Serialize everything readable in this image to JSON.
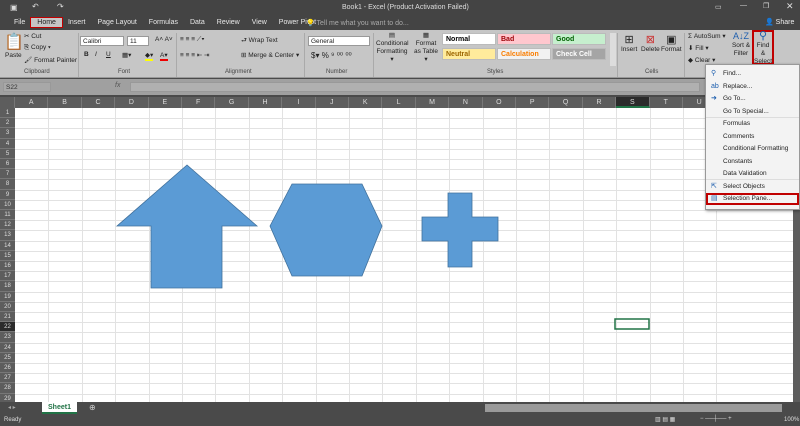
{
  "title": "Book1 - Excel (Product Activation Failed)",
  "tabs": [
    "File",
    "Home",
    "Insert",
    "Page Layout",
    "Formulas",
    "Data",
    "Review",
    "View",
    "Power Pivot"
  ],
  "tell_me": "Tell me what you want to do...",
  "share": "Share",
  "clipboard": {
    "paste": "Paste",
    "cut": "Cut",
    "copy": "Copy",
    "format_painter": "Format Painter",
    "label": "Clipboard"
  },
  "font": {
    "name": "Calibri",
    "size": "11",
    "label": "Font",
    "bold": "B",
    "italic": "I",
    "underline": "U"
  },
  "alignment": {
    "wrap": "Wrap Text",
    "merge": "Merge & Center",
    "label": "Alignment"
  },
  "number": {
    "format": "General",
    "label": "Number",
    "currency": "$",
    "percent": "%"
  },
  "styles": {
    "conditional": "Conditional Formatting",
    "format_table": "Format as Table",
    "label": "Styles",
    "cells": [
      {
        "t": "Normal",
        "bg": "#ffffff",
        "c": "#000"
      },
      {
        "t": "Bad",
        "bg": "#ffc7ce",
        "c": "#9c0006"
      },
      {
        "t": "Good",
        "bg": "#c6efce",
        "c": "#006100"
      },
      {
        "t": "Neutral",
        "bg": "#ffeb9c",
        "c": "#9c6500"
      },
      {
        "t": "Calculation",
        "bg": "#f2f2f2",
        "c": "#fa7d00"
      },
      {
        "t": "Check Cell",
        "bg": "#a5a5a5",
        "c": "#ffffff"
      }
    ]
  },
  "cells": {
    "insert": "Insert",
    "delete": "Delete",
    "format": "Format",
    "label": "Cells"
  },
  "editing": {
    "autosum": "AutoSum",
    "fill": "Fill",
    "clear": "Clear",
    "sort": "Sort & Filter",
    "find": "Find & Select"
  },
  "name_box": "S22",
  "fx": "fx",
  "columns": [
    "A",
    "B",
    "C",
    "D",
    "E",
    "F",
    "G",
    "H",
    "I",
    "J",
    "K",
    "L",
    "M",
    "N",
    "O",
    "P",
    "Q",
    "R",
    "S",
    "T",
    "U"
  ],
  "row_count": 29,
  "selected_cell": {
    "col": "S",
    "row": 22
  },
  "shape_color": "#5b9bd5",
  "menu": [
    {
      "label": "Find...",
      "icon": "search-icon"
    },
    {
      "label": "Replace...",
      "icon": "replace-icon"
    },
    {
      "label": "Go To...",
      "icon": "arrow-right-icon"
    },
    {
      "label": "Go To Special..."
    },
    {
      "label": "Formulas"
    },
    {
      "label": "Comments"
    },
    {
      "label": "Conditional Formatting"
    },
    {
      "label": "Constants"
    },
    {
      "label": "Data Validation"
    },
    {
      "label": "Select Objects",
      "icon": "pointer-icon"
    },
    {
      "label": "Selection Pane...",
      "icon": "selection-pane-icon"
    }
  ],
  "sheet_tab": "Sheet1",
  "status": "Ready",
  "zoom": "100%"
}
